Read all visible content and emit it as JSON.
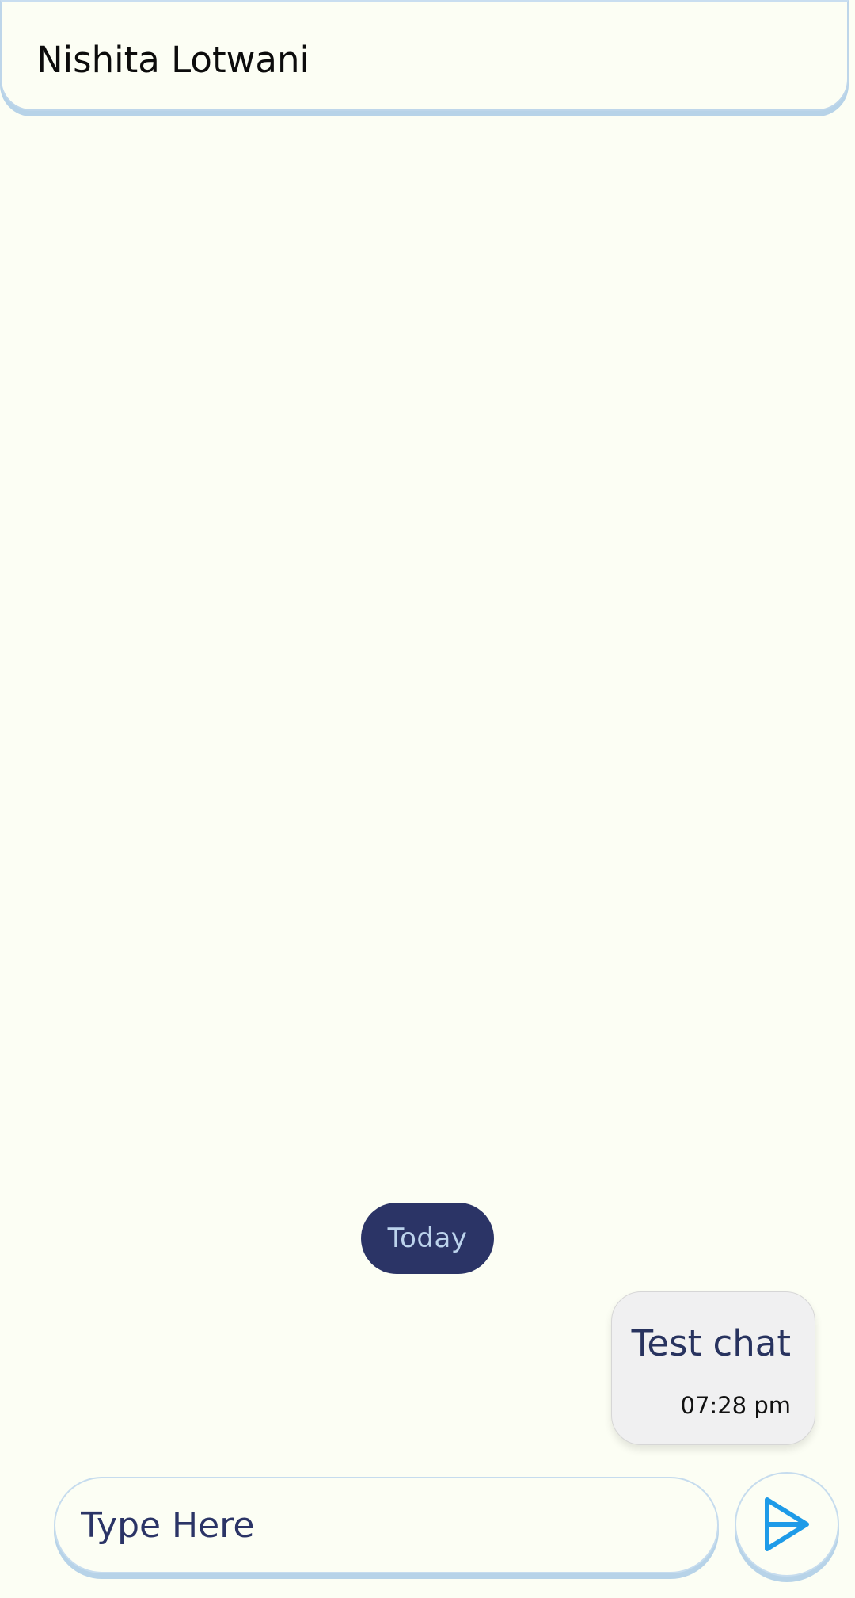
{
  "header": {
    "title": "Nishita Lotwani"
  },
  "chat": {
    "date_separator": "Today",
    "messages": [
      {
        "text": "Test chat",
        "time": "07:28 pm",
        "direction": "outgoing"
      }
    ]
  },
  "composer": {
    "placeholder": "Type Here",
    "value": "",
    "send_icon": "send-icon"
  },
  "colors": {
    "background": "#fcfef4",
    "accent_navy": "#2b3466",
    "chip_text": "#bcd3ec",
    "border_blue": "#b7d3e8",
    "send_icon": "#1e9be8",
    "bubble_bg": "#f0f0f1"
  }
}
